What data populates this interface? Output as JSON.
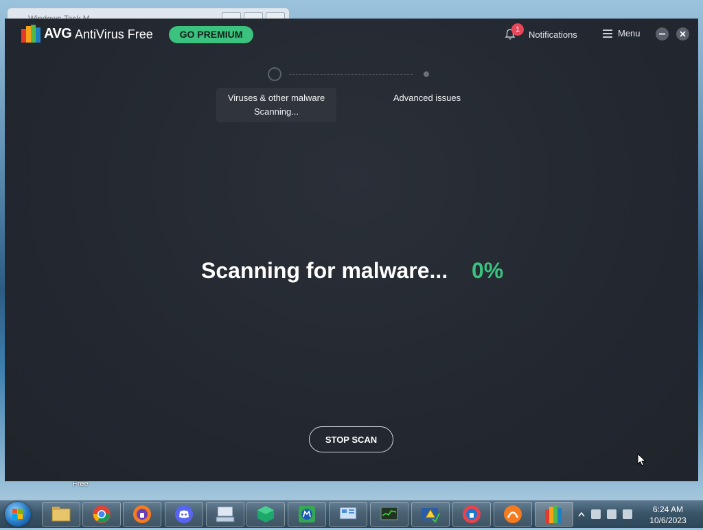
{
  "desktop": {
    "background_window_title": "Windows Task M...",
    "desktop_icon_label": "Free"
  },
  "app": {
    "logo_text": "AVG",
    "product_name": "AntiVirus Free",
    "go_premium_label": "GO PREMIUM",
    "notifications_count": "1",
    "notifications_label": "Notifications",
    "menu_label": "Menu"
  },
  "steps": {
    "step1_title": "Viruses & other malware",
    "step1_status": "Scanning...",
    "step2_title": "Advanced issues"
  },
  "scan": {
    "status_text": "Scanning for malware...",
    "progress": "0%",
    "stop_label": "STOP SCAN"
  },
  "colors": {
    "accent_green": "#3bc27e",
    "badge_red": "#e4475a",
    "window_bg": "#23282f"
  },
  "taskbar": {
    "items": [
      "file-explorer-icon",
      "chrome-icon",
      "avast-secure-browser-icon",
      "discord-icon",
      "keyboard-app-icon",
      "green-cube-app-icon",
      "malwarebytes-icon",
      "control-panel-icon",
      "task-manager-icon",
      "action-center-icon",
      "avg-secure-browser-icon",
      "avast-antivirus-icon",
      "avg-antivirus-icon"
    ],
    "clock_time": "6:24 AM",
    "clock_date": "10/6/2023"
  }
}
